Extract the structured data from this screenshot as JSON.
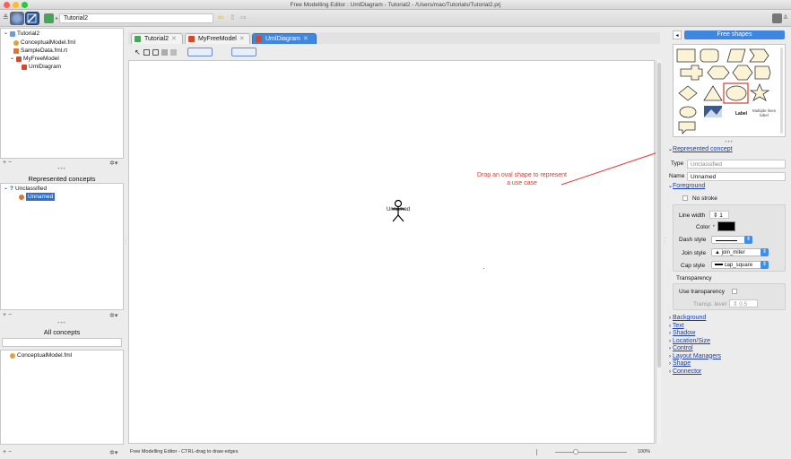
{
  "window": {
    "title": "Free Modelling Editor : UmlDiagram - Tutorial2 - /Users/mac/Tutorials/Tutorial2.prj"
  },
  "toolbar": {
    "path": "Tutorial2"
  },
  "project_tree": {
    "items": [
      {
        "label": "Tutorial2",
        "level": 0
      },
      {
        "label": "ConceptualModel.fml",
        "level": 1
      },
      {
        "label": "SampleData.fml.rt",
        "level": 1
      },
      {
        "label": "MyFreeModel",
        "level": 1
      },
      {
        "label": "UmlDiagram",
        "level": 2
      }
    ]
  },
  "represented_concepts": {
    "title": "Represented concepts",
    "items": [
      {
        "label": "Unclassified",
        "level": 0
      },
      {
        "label": "Unnamed",
        "level": 1
      }
    ]
  },
  "all_concepts": {
    "title": "All concepts",
    "items": [
      {
        "label": "ConceptualModel.fml"
      }
    ]
  },
  "tabs": [
    {
      "label": "Tutorial2",
      "active": false
    },
    {
      "label": "MyFreeModel",
      "active": false
    },
    {
      "label": "UmlDiagram",
      "active": true
    }
  ],
  "canvas": {
    "actor_label": "Unnamed",
    "annotation": "Drop an oval shape to represent a use case"
  },
  "status": {
    "text": "Free Modelling Editor - CTRL-drag to draw edges",
    "zoom": "100%"
  },
  "palette": {
    "title": "Free shapes",
    "label_shape": "Label",
    "multiline_shape": "Multiple lines label"
  },
  "inspector": {
    "represented_concept": "Represented concept",
    "type_label": "Type",
    "type_value": "Unclassified",
    "name_label": "Name",
    "name_value": "Unnamed",
    "foreground": "Foreground",
    "no_stroke": "No stroke",
    "line_width_label": "Line width",
    "line_width_value": "1",
    "color_label": "Color",
    "dash_style_label": "Dash style",
    "join_style_label": "Join style",
    "join_style_value": "join_miter",
    "cap_style_label": "Cap style",
    "cap_style_value": "cap_square",
    "transparency": "Transparency",
    "use_transparency": "Use transparency",
    "transp_level_label": "Transp. level",
    "transp_level_value": "0.5",
    "sections": [
      "Background",
      "Text",
      "Shadow",
      "Location/Size",
      "Control",
      "Layout Managers",
      "Shape",
      "Connector"
    ]
  },
  "colors": {
    "accent": "#3f86e0",
    "annotation": "#e0382a",
    "link": "#1a3fb0"
  }
}
